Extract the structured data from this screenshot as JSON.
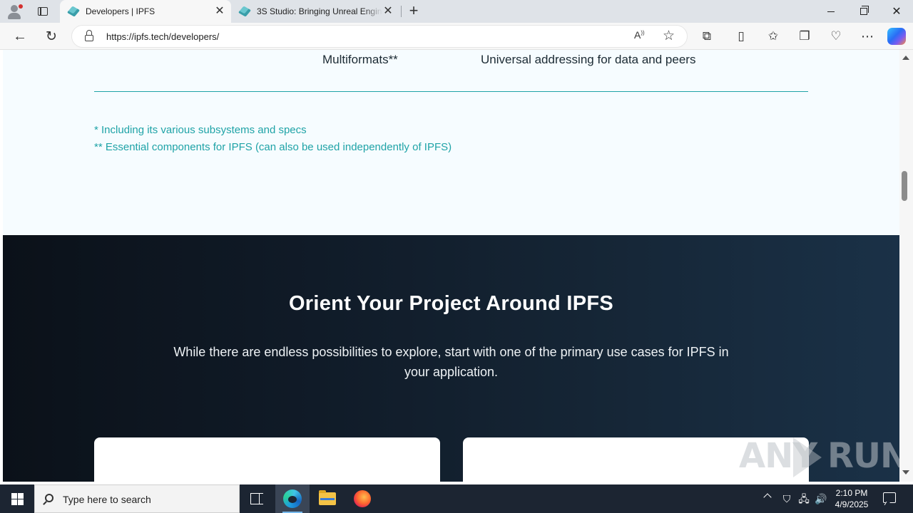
{
  "browser": {
    "tabs": [
      {
        "title": "Developers | IPFS",
        "active": true
      },
      {
        "title": "3S Studio: Bringing Unreal Engine",
        "active": false
      }
    ],
    "address": {
      "url": "https://ipfs.tech/developers/"
    }
  },
  "page": {
    "table_last_row": {
      "name": "Multiformats**",
      "description": "Universal addressing for data and peers"
    },
    "footnotes": [
      "* Including its various subsystems and specs",
      "** Essential components for IPFS (can also be used independently of IPFS)"
    ],
    "orient": {
      "heading": "Orient Your Project Around IPFS",
      "body": "While there are endless possibilities to explore, start with one of the primary use cases for IPFS in your application."
    }
  },
  "watermark": {
    "left": "ANY",
    "right": "RUN"
  },
  "taskbar": {
    "search_placeholder": "Type here to search",
    "clock_time": "2:10 PM",
    "clock_date": "4/9/2025"
  },
  "colors": {
    "accent_teal": "#1fa3a7",
    "dark_section": "#101b28",
    "taskbar": "#1c2532"
  }
}
